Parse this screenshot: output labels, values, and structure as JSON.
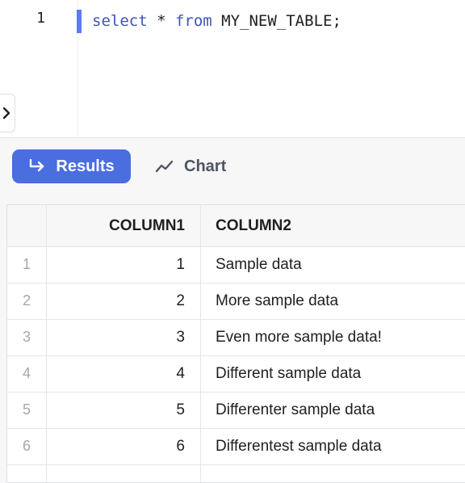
{
  "editor": {
    "line_number": "1",
    "code": {
      "kw_select": "select",
      "star": " * ",
      "kw_from": "from",
      "rest": " MY_NEW_TABLE;"
    },
    "collapse_icon": "chevron-right-icon"
  },
  "tabs": {
    "results_label": "Results",
    "results_icon": "return-arrow-icon",
    "chart_label": "Chart",
    "chart_icon": "line-chart-icon",
    "active": "Results",
    "accent_color": "#4a6ee0"
  },
  "grid": {
    "columns": [
      "COLUMN1",
      "COLUMN2"
    ],
    "rows": [
      {
        "index": "1",
        "column1": "1",
        "column2": "Sample data"
      },
      {
        "index": "2",
        "column1": "2",
        "column2": "More sample data"
      },
      {
        "index": "3",
        "column1": "3",
        "column2": "Even more sample data!"
      },
      {
        "index": "4",
        "column1": "4",
        "column2": "Different sample data"
      },
      {
        "index": "5",
        "column1": "5",
        "column2": "Differenter sample data"
      },
      {
        "index": "6",
        "column1": "6",
        "column2": "Differentest sample data"
      }
    ]
  }
}
